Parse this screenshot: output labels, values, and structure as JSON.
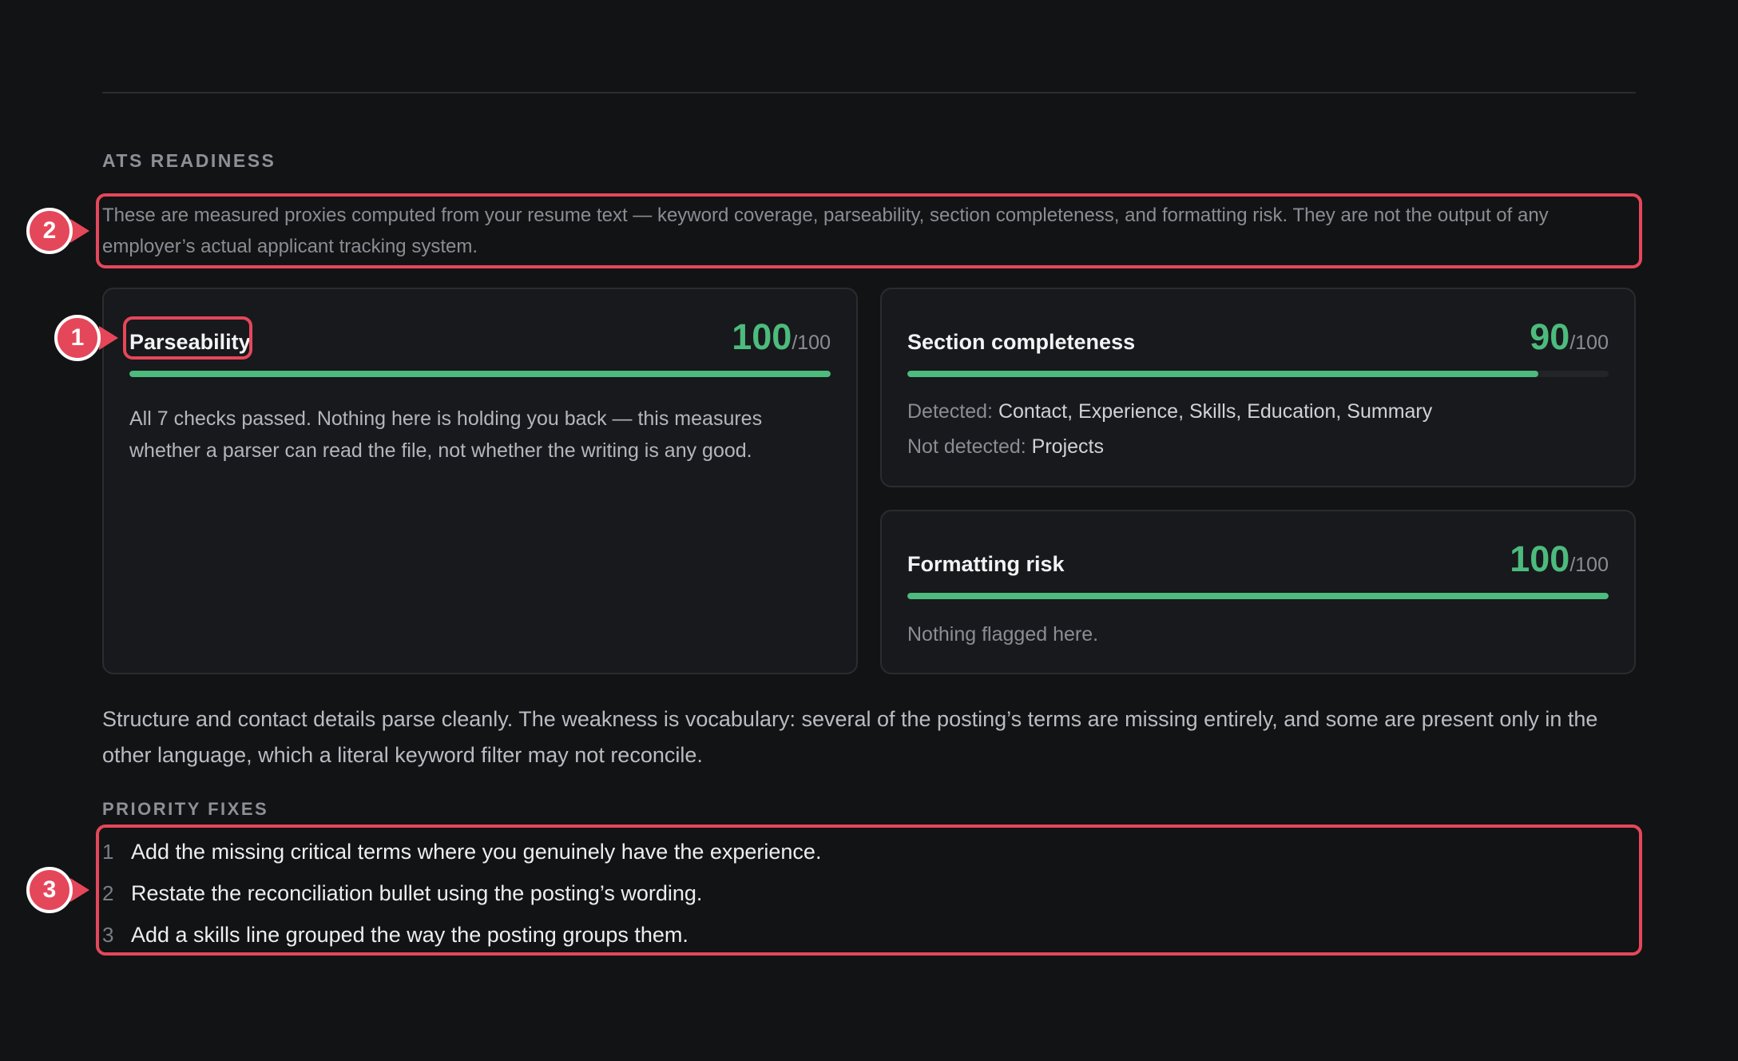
{
  "section": {
    "label": "ATS READINESS",
    "intro": "These are measured proxies computed from your resume text — keyword coverage, parseability, section completeness, and formatting risk. They are not the output of any employer’s actual applicant tracking system."
  },
  "cards": {
    "parseability": {
      "title": "Parseability",
      "score": "100",
      "max": "/100",
      "progress": 1.0,
      "text": "All 7 checks passed. Nothing here is holding you back — this measures whether a parser can read the file, not whether the writing is any good."
    },
    "section_completeness": {
      "title": "Section completeness",
      "score": "90",
      "max": "/100",
      "progress": 0.9,
      "detected_label": "Detected:",
      "detected_value": "Contact, Experience, Skills, Education, Summary",
      "not_detected_label": "Not detected:",
      "not_detected_value": "Projects"
    },
    "formatting_risk": {
      "title": "Formatting risk",
      "score": "100",
      "max": "/100",
      "progress": 1.0,
      "text": "Nothing flagged here."
    }
  },
  "summary": "Structure and contact details parse cleanly. The weakness is vocabulary: several of the posting’s terms are missing entirely, and some are present only in the other language, which a literal keyword filter may not reconcile.",
  "priority_fixes": {
    "label": "PRIORITY FIXES",
    "items": [
      {
        "num": "1",
        "text": "Add the missing critical terms where you genuinely have the experience."
      },
      {
        "num": "2",
        "text": "Restate the reconciliation bullet using the posting’s wording."
      },
      {
        "num": "3",
        "text": "Add a skills line grouped the way the posting groups them."
      }
    ]
  },
  "annotations": {
    "badge_1": "1",
    "badge_2": "2",
    "badge_3": "3",
    "color": "#e5475a"
  },
  "colors": {
    "background": "#121315",
    "card": "#18191c",
    "accent_green": "#4cbb7d"
  }
}
